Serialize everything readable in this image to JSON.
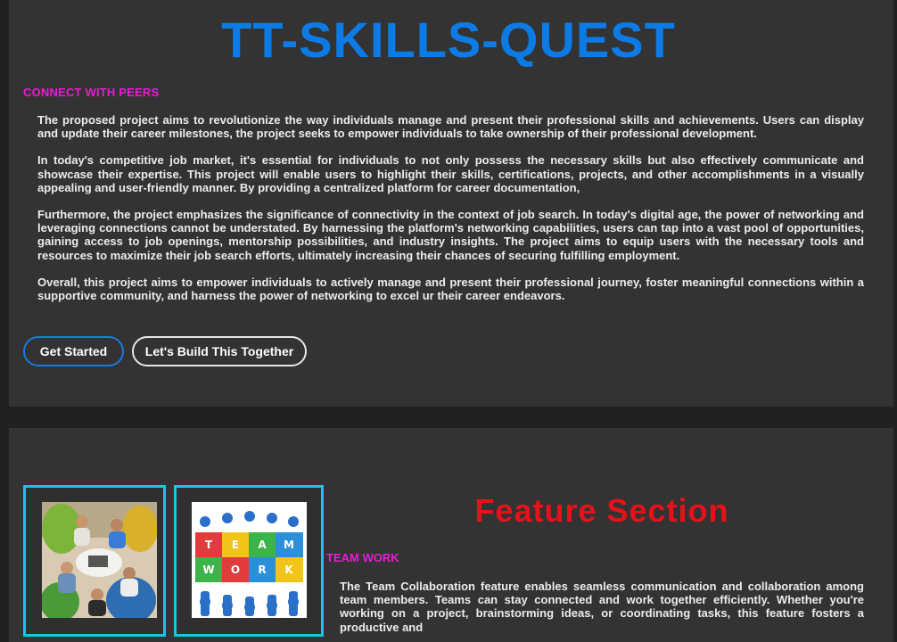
{
  "hero": {
    "title": "TT-SKILLS-QUEST",
    "kicker": "CONNECT WITH PEERS",
    "paragraphs": [
      "The proposed project aims to revolutionize the way individuals manage and present their professional skills and achievements. Users can display and update their career milestones, the project seeks to empower individuals to take ownership of their professional development.",
      "In today's competitive job market, it's essential for individuals to not only possess the necessary skills but also effectively communicate and showcase their expertise. This project will enable users to highlight their skills, certifications, projects, and other accomplishments in a visually appealing and user-friendly manner. By providing a centralized platform for career documentation,",
      "Furthermore, the project emphasizes the significance of connectivity in the context of job search. In today's digital age, the power of networking and leveraging connections cannot be understated. By harnessing the platform's networking capabilities, users can tap into a vast pool of opportunities, gaining access to job openings, mentorship possibilities, and industry insights. The project aims to equip users with the necessary tools and resources to maximize their job search efforts, ultimately increasing their chances of securing fulfilling employment.",
      "Overall, this project aims to empower individuals to actively manage and present their professional journey, foster meaningful connections within a supportive community, and harness the power of networking to excel ur their career endeavors."
    ],
    "buttons": {
      "get_started": "Get Started",
      "build_together": "Let's Build This Together"
    }
  },
  "features": {
    "title": "Feature Section",
    "kicker": "TEAM WORK",
    "text": "The Team Collaboration feature enables seamless communication and collaboration among team members. Teams can stay connected and work together efficiently. Whether you're working on a project, brainstorming ideas, or coordinating tasks, this feature fosters a productive and",
    "puzzle_letters": [
      "T",
      "E",
      "A",
      "M",
      "W",
      "O",
      "R",
      "K"
    ]
  },
  "colors": {
    "title_blue": "#0d7be6",
    "accent_magenta": "#e81cd2",
    "feature_red": "#e8111a",
    "card_border_cyan": "#19c4e6"
  }
}
